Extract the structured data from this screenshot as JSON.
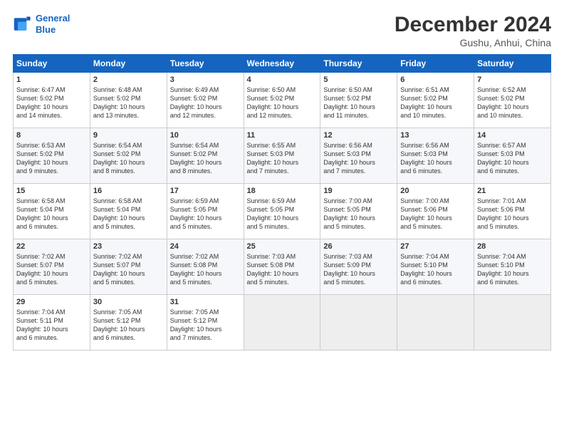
{
  "logo": {
    "line1": "General",
    "line2": "Blue"
  },
  "title": "December 2024",
  "location": "Gushu, Anhui, China",
  "days_of_week": [
    "Sunday",
    "Monday",
    "Tuesday",
    "Wednesday",
    "Thursday",
    "Friday",
    "Saturday"
  ],
  "weeks": [
    [
      {
        "day": "1",
        "text": "Sunrise: 6:47 AM\nSunset: 5:02 PM\nDaylight: 10 hours\nand 14 minutes."
      },
      {
        "day": "2",
        "text": "Sunrise: 6:48 AM\nSunset: 5:02 PM\nDaylight: 10 hours\nand 13 minutes."
      },
      {
        "day": "3",
        "text": "Sunrise: 6:49 AM\nSunset: 5:02 PM\nDaylight: 10 hours\nand 12 minutes."
      },
      {
        "day": "4",
        "text": "Sunrise: 6:50 AM\nSunset: 5:02 PM\nDaylight: 10 hours\nand 12 minutes."
      },
      {
        "day": "5",
        "text": "Sunrise: 6:50 AM\nSunset: 5:02 PM\nDaylight: 10 hours\nand 11 minutes."
      },
      {
        "day": "6",
        "text": "Sunrise: 6:51 AM\nSunset: 5:02 PM\nDaylight: 10 hours\nand 10 minutes."
      },
      {
        "day": "7",
        "text": "Sunrise: 6:52 AM\nSunset: 5:02 PM\nDaylight: 10 hours\nand 10 minutes."
      }
    ],
    [
      {
        "day": "8",
        "text": "Sunrise: 6:53 AM\nSunset: 5:02 PM\nDaylight: 10 hours\nand 9 minutes."
      },
      {
        "day": "9",
        "text": "Sunrise: 6:54 AM\nSunset: 5:02 PM\nDaylight: 10 hours\nand 8 minutes."
      },
      {
        "day": "10",
        "text": "Sunrise: 6:54 AM\nSunset: 5:02 PM\nDaylight: 10 hours\nand 8 minutes."
      },
      {
        "day": "11",
        "text": "Sunrise: 6:55 AM\nSunset: 5:03 PM\nDaylight: 10 hours\nand 7 minutes."
      },
      {
        "day": "12",
        "text": "Sunrise: 6:56 AM\nSunset: 5:03 PM\nDaylight: 10 hours\nand 7 minutes."
      },
      {
        "day": "13",
        "text": "Sunrise: 6:56 AM\nSunset: 5:03 PM\nDaylight: 10 hours\nand 6 minutes."
      },
      {
        "day": "14",
        "text": "Sunrise: 6:57 AM\nSunset: 5:03 PM\nDaylight: 10 hours\nand 6 minutes."
      }
    ],
    [
      {
        "day": "15",
        "text": "Sunrise: 6:58 AM\nSunset: 5:04 PM\nDaylight: 10 hours\nand 6 minutes."
      },
      {
        "day": "16",
        "text": "Sunrise: 6:58 AM\nSunset: 5:04 PM\nDaylight: 10 hours\nand 5 minutes."
      },
      {
        "day": "17",
        "text": "Sunrise: 6:59 AM\nSunset: 5:05 PM\nDaylight: 10 hours\nand 5 minutes."
      },
      {
        "day": "18",
        "text": "Sunrise: 6:59 AM\nSunset: 5:05 PM\nDaylight: 10 hours\nand 5 minutes."
      },
      {
        "day": "19",
        "text": "Sunrise: 7:00 AM\nSunset: 5:05 PM\nDaylight: 10 hours\nand 5 minutes."
      },
      {
        "day": "20",
        "text": "Sunrise: 7:00 AM\nSunset: 5:06 PM\nDaylight: 10 hours\nand 5 minutes."
      },
      {
        "day": "21",
        "text": "Sunrise: 7:01 AM\nSunset: 5:06 PM\nDaylight: 10 hours\nand 5 minutes."
      }
    ],
    [
      {
        "day": "22",
        "text": "Sunrise: 7:02 AM\nSunset: 5:07 PM\nDaylight: 10 hours\nand 5 minutes."
      },
      {
        "day": "23",
        "text": "Sunrise: 7:02 AM\nSunset: 5:07 PM\nDaylight: 10 hours\nand 5 minutes."
      },
      {
        "day": "24",
        "text": "Sunrise: 7:02 AM\nSunset: 5:08 PM\nDaylight: 10 hours\nand 5 minutes."
      },
      {
        "day": "25",
        "text": "Sunrise: 7:03 AM\nSunset: 5:08 PM\nDaylight: 10 hours\nand 5 minutes."
      },
      {
        "day": "26",
        "text": "Sunrise: 7:03 AM\nSunset: 5:09 PM\nDaylight: 10 hours\nand 5 minutes."
      },
      {
        "day": "27",
        "text": "Sunrise: 7:04 AM\nSunset: 5:10 PM\nDaylight: 10 hours\nand 6 minutes."
      },
      {
        "day": "28",
        "text": "Sunrise: 7:04 AM\nSunset: 5:10 PM\nDaylight: 10 hours\nand 6 minutes."
      }
    ],
    [
      {
        "day": "29",
        "text": "Sunrise: 7:04 AM\nSunset: 5:11 PM\nDaylight: 10 hours\nand 6 minutes."
      },
      {
        "day": "30",
        "text": "Sunrise: 7:05 AM\nSunset: 5:12 PM\nDaylight: 10 hours\nand 6 minutes."
      },
      {
        "day": "31",
        "text": "Sunrise: 7:05 AM\nSunset: 5:12 PM\nDaylight: 10 hours\nand 7 minutes."
      },
      {
        "day": "",
        "text": ""
      },
      {
        "day": "",
        "text": ""
      },
      {
        "day": "",
        "text": ""
      },
      {
        "day": "",
        "text": ""
      }
    ]
  ]
}
